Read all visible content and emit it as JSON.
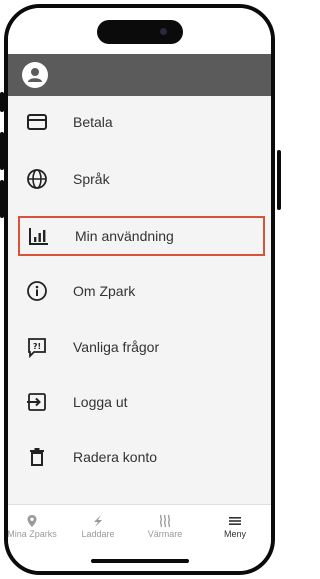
{
  "menu": {
    "items": [
      {
        "label": "Betala",
        "icon": "credit-card-icon"
      },
      {
        "label": "Språk",
        "icon": "globe-icon"
      },
      {
        "label": "Min användning",
        "icon": "bar-chart-icon",
        "selected": true
      },
      {
        "label": "Om Zpark",
        "icon": "info-icon"
      },
      {
        "label": "Vanliga frågor",
        "icon": "faq-icon"
      },
      {
        "label": "Logga ut",
        "icon": "logout-icon"
      },
      {
        "label": "Radera konto",
        "icon": "trash-icon"
      }
    ]
  },
  "nav": {
    "tabs": [
      {
        "label": "Mina Zparks",
        "icon": "location-pin-icon"
      },
      {
        "label": "Laddare",
        "icon": "lightning-icon"
      },
      {
        "label": "Värmare",
        "icon": "heat-icon"
      },
      {
        "label": "Meny",
        "icon": "menu-icon",
        "active": true
      }
    ]
  },
  "colors": {
    "header": "#5b5b5b",
    "selected_border": "#d9533b",
    "background": "#f4f4f4"
  }
}
